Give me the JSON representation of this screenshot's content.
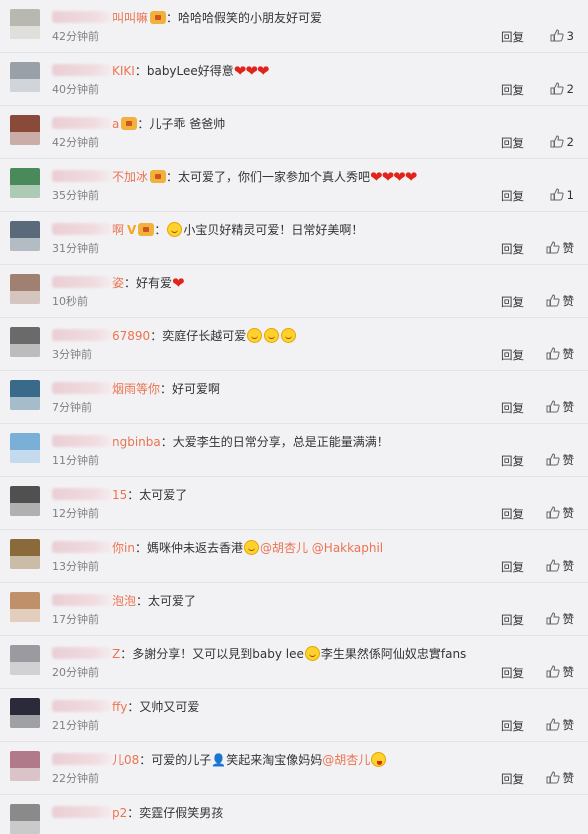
{
  "reply_label": "回复",
  "like_label": "赞",
  "comments": [
    {
      "name": "叫叫嘛",
      "badge": true,
      "text": "哈哈哈假笑的小朋友好可爱",
      "time": "42分钟前",
      "likes": "3",
      "avatar": "#b8b8b0"
    },
    {
      "name": "KIKI",
      "text": "babyLee好得意",
      "hearts": "❤❤❤",
      "time": "40分钟前",
      "likes": "2",
      "avatar": "#9aa0a8"
    },
    {
      "name": "a",
      "badge": true,
      "text": "儿子乖 爸爸帅",
      "time": "42分钟前",
      "likes": "2",
      "avatar": "#8a4a3a"
    },
    {
      "name": "不加冰",
      "badge": true,
      "text": "太可爱了，你们一家参加个真人秀吧",
      "hearts": "❤❤❤❤",
      "time": "35分钟前",
      "likes": "1",
      "avatar": "#4a8a5a"
    },
    {
      "name": "啊",
      "vip": true,
      "badge": true,
      "pre_emoji": "smile",
      "text": "小宝贝好精灵可爱！日常好美啊！",
      "time": "31分钟前",
      "likes": "赞",
      "avatar": "#5a6a7a"
    },
    {
      "name": "姿",
      "text": "好有爱",
      "hearts": "❤",
      "time": "10秒前",
      "likes": "赞",
      "avatar": "#a08070"
    },
    {
      "name": "67890",
      "text": "奕庭仔长越可爱",
      "emojis": [
        "smile",
        "smile",
        "smile"
      ],
      "time": "3分钟前",
      "likes": "赞",
      "avatar": "#6a6a6a"
    },
    {
      "name": "烟雨等你",
      "text": "好可爱啊",
      "time": "7分钟前",
      "likes": "赞",
      "avatar": "#3a6a8a"
    },
    {
      "name": "ngbinba",
      "text": "大爱李生的日常分享，总是正能量满满！",
      "time": "11分钟前",
      "likes": "赞",
      "avatar": "#7ab0d8"
    },
    {
      "name": "15",
      "text": "太可爱了",
      "time": "12分钟前",
      "likes": "赞",
      "avatar": "#505050"
    },
    {
      "name": "你in",
      "text": "媽咪仲未返去香港",
      "mid_emoji": "smile",
      "mentions": "@胡杏儿 @Hakkaphil",
      "time": "13分钟前",
      "likes": "赞",
      "avatar": "#8a6a3a"
    },
    {
      "name": "泡泡",
      "text": "太可爱了",
      "time": "17分钟前",
      "likes": "赞",
      "avatar": "#c0906a"
    },
    {
      "name": "Z",
      "text": "多謝分享！又可以見到baby lee",
      "mid_emoji": "smile",
      "text2": "李生果然係阿仙奴忠實fans",
      "time": "20分钟前",
      "likes": "赞",
      "avatar": "#9a9aa0"
    },
    {
      "name": "ffy",
      "text": "又帅又可爱",
      "time": "21分钟前",
      "likes": "赞",
      "avatar": "#2a2a3a"
    },
    {
      "name": "儿08",
      "text": "可爱的儿子👤笑起来淘宝像妈妈",
      "mentions": "@胡杏儿",
      "post_emoji": "tongue",
      "time": "22分钟前",
      "likes": "赞",
      "avatar": "#b07a8a"
    },
    {
      "name": "p2",
      "text": "奕霆仔假笑男孩",
      "time": "",
      "likes": "",
      "avatar": "#8a8a8a"
    }
  ]
}
